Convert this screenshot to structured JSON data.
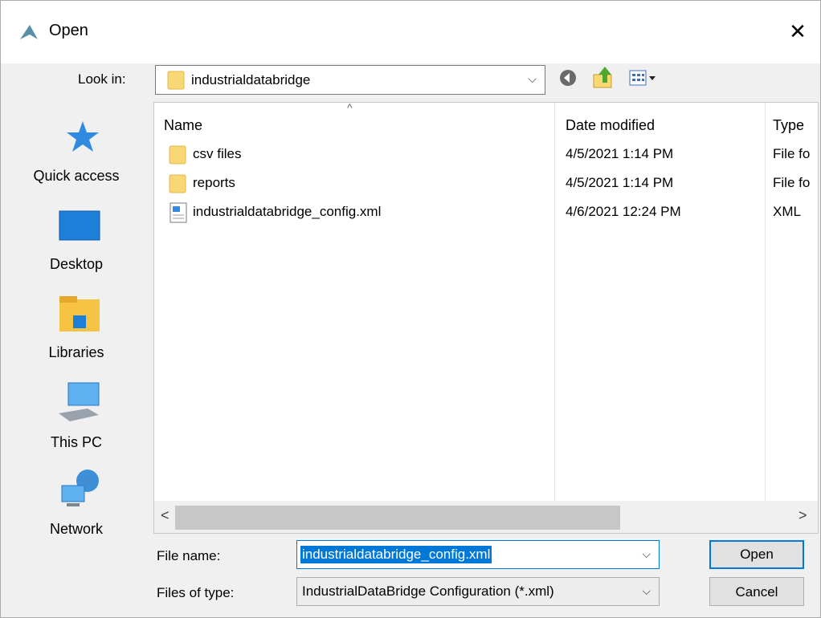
{
  "window": {
    "title": "Open",
    "close_glyph": "✕"
  },
  "look_in": {
    "label": "Look in:",
    "value": "industrialdatabridge",
    "dropdown_glyph": "⌵"
  },
  "toolbar": {
    "back_icon": "back-arrow-icon",
    "up_icon": "up-folder-icon",
    "view_icon": "view-menu-icon"
  },
  "places": [
    {
      "label": "Quick access",
      "icon": "star-icon"
    },
    {
      "label": "Desktop",
      "icon": "desktop-icon"
    },
    {
      "label": "Libraries",
      "icon": "libraries-icon"
    },
    {
      "label": "This PC",
      "icon": "computer-icon"
    },
    {
      "label": "Network",
      "icon": "network-icon"
    }
  ],
  "file_list": {
    "columns": {
      "name": "Name",
      "date": "Date modified",
      "type": "Type"
    },
    "sort_glyph": "^",
    "rows": [
      {
        "name": "csv files",
        "date": "4/5/2021 1:14 PM",
        "type": "File fo",
        "icon": "folder-icon"
      },
      {
        "name": "reports",
        "date": "4/5/2021 1:14 PM",
        "type": "File fo",
        "icon": "folder-icon"
      },
      {
        "name": "industrialdatabridge_config.xml",
        "date": "4/6/2021 12:24 PM",
        "type": "XML",
        "icon": "xml-file-icon"
      }
    ],
    "scroll_left": "<",
    "scroll_right": ">"
  },
  "file_name": {
    "label": "File name:",
    "value": "industrialdatabridge_config.xml"
  },
  "file_type": {
    "label": "Files of type:",
    "value": "IndustrialDataBridge Configuration (*.xml)"
  },
  "buttons": {
    "open": "Open",
    "cancel": "Cancel"
  },
  "colors": {
    "accent": "#0078d7",
    "folder": "#f8d775",
    "selection": "#0078d7"
  }
}
